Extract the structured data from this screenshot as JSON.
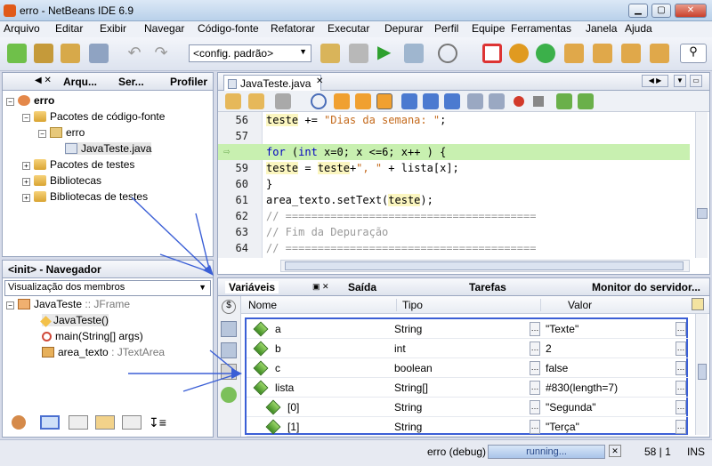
{
  "window": {
    "title": "erro - NetBeans IDE 6.9"
  },
  "menubar": {
    "items": [
      "Arquivo",
      "Editar",
      "Exibir",
      "Navegar",
      "Código-fonte",
      "Refatorar",
      "Executar",
      "Depurar",
      "Perfil",
      "Equipe",
      "Ferramentas",
      "Janela",
      "Ajuda"
    ]
  },
  "toolbar": {
    "config": "<config. padrão>"
  },
  "projects": {
    "tabs": [
      "Arqu...",
      "Ser...",
      "Profiler"
    ],
    "tree": [
      {
        "label": "erro",
        "level": 0
      },
      {
        "label": "Pacotes de código-fonte",
        "level": 1
      },
      {
        "label": "erro",
        "level": 2
      },
      {
        "label": "JavaTeste.java",
        "level": 3
      },
      {
        "label": "Pacotes de testes",
        "level": 1
      },
      {
        "label": "Bibliotecas",
        "level": 1
      },
      {
        "label": "Bibliotecas de testes",
        "level": 1
      }
    ]
  },
  "navigator": {
    "title": "<init> - Navegador",
    "view": "Visualização dos membros",
    "root": "JavaTeste",
    "root_type": ":: JFrame",
    "members": [
      {
        "name": "JavaTeste()",
        "type": ""
      },
      {
        "name": "main(String[] args)",
        "type": ""
      },
      {
        "name": "area_texto",
        "type": ": JTextArea"
      }
    ]
  },
  "editor": {
    "tab": "JavaTeste.java",
    "lines": [
      {
        "n": "56",
        "parts": [
          [
            "teste",
            "hl"
          ],
          [
            " += ",
            ""
          ],
          [
            "\"Dias da semana: \"",
            "str"
          ],
          [
            ";",
            ""
          ]
        ]
      },
      {
        "n": "57",
        "parts": []
      },
      {
        "n": "58",
        "parts": [
          [
            "for",
            "kw"
          ],
          [
            " (",
            ""
          ],
          [
            "int",
            "kw"
          ],
          [
            " x=0; x <=6; x++ ) {",
            ""
          ]
        ],
        "current": true
      },
      {
        "n": "59",
        "parts": [
          [
            "teste",
            "hl"
          ],
          [
            " = ",
            ""
          ],
          [
            "teste",
            "hl"
          ],
          [
            "+",
            ""
          ],
          [
            "\", \"",
            "str"
          ],
          [
            " + lista[x];",
            ""
          ]
        ]
      },
      {
        "n": "60",
        "parts": [
          [
            "}",
            ""
          ]
        ]
      },
      {
        "n": "61",
        "parts": [
          [
            "area_texto.setText(",
            ""
          ],
          [
            "teste",
            "hl"
          ],
          [
            ");",
            ""
          ]
        ]
      },
      {
        "n": "62",
        "parts": [
          [
            "// =======================================",
            "cm"
          ]
        ]
      },
      {
        "n": "63",
        "parts": [
          [
            "// Fim da Depuração",
            "cm"
          ]
        ]
      },
      {
        "n": "64",
        "parts": [
          [
            "// =======================================",
            "cm"
          ]
        ]
      }
    ]
  },
  "bottom": {
    "tabs": [
      "Variáveis",
      "Saída",
      "Tarefas",
      "Monitor do servidor..."
    ],
    "columns": [
      "Nome",
      "Tipo",
      "Valor"
    ],
    "rows": [
      {
        "name": "a",
        "type": "String",
        "value": "\"Texte\"",
        "indent": 0
      },
      {
        "name": "b",
        "type": "int",
        "value": "2",
        "indent": 0
      },
      {
        "name": "c",
        "type": "boolean",
        "value": "false",
        "indent": 0
      },
      {
        "name": "lista",
        "type": "String[]",
        "value": "#830(length=7)",
        "indent": 0
      },
      {
        "name": "[0]",
        "type": "String",
        "value": "\"Segunda\"",
        "indent": 1
      },
      {
        "name": "[1]",
        "type": "String",
        "value": "\"Terça\"",
        "indent": 1
      }
    ]
  },
  "status": {
    "session": "erro (debug)",
    "progress": "running...",
    "position": "58 | 1",
    "mode": "INS"
  },
  "colors": {
    "accent": "#3b5fd6",
    "current_line": "#c8f0b0"
  }
}
